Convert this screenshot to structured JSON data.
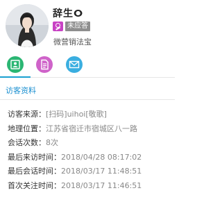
{
  "profile": {
    "name": "辞生ⵔ",
    "status_tag": "未应答",
    "source_name": "微营销法宝",
    "avatar": "woman-portrait",
    "badge_icon": "pin-icon",
    "badge_color": "#c842c4"
  },
  "actions": [
    {
      "icon": "contact-card-icon",
      "color": "#2bb673"
    },
    {
      "icon": "document-icon",
      "color": "#cf63c9"
    },
    {
      "icon": "mail-icon",
      "color": "#3aaee0"
    }
  ],
  "tab": {
    "title": "访客资料",
    "accent": "#1a8fd0"
  },
  "info": [
    {
      "label": "访客来源：",
      "value": "[扫码]uihoi[敬歌]"
    },
    {
      "label": "地理位置：",
      "value": "江苏省宿迁市宿城区八一路"
    },
    {
      "label": "会话次数：",
      "value": "8次"
    },
    {
      "label": "最后来访时间：",
      "value": "2018/04/28 08:17:02"
    },
    {
      "label": "最后会话时间：",
      "value": "2018/03/17 11:48:51"
    },
    {
      "label": "首次关注时间：",
      "value": "2018/03/17 11:46:51"
    }
  ]
}
